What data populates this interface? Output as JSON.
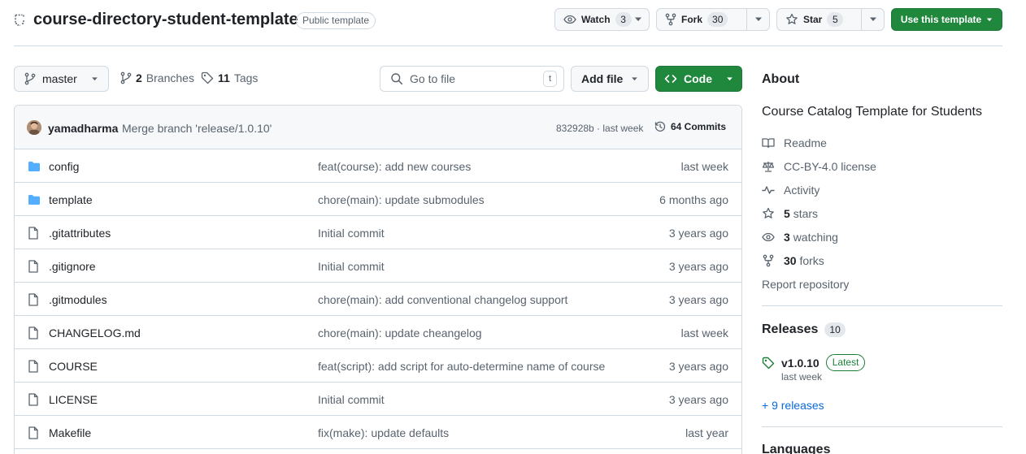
{
  "header": {
    "repo_name": "course-directory-student-template",
    "visibility": "Public template",
    "watch_label": "Watch",
    "watch_count": "3",
    "fork_label": "Fork",
    "fork_count": "30",
    "star_label": "Star",
    "star_count": "5",
    "use_template_label": "Use this template"
  },
  "nav": {
    "branch": "master",
    "branches_count": "2",
    "branches_label": "Branches",
    "tags_count": "11",
    "tags_label": "Tags",
    "go_to_file_placeholder": "Go to file",
    "go_to_file_key": "t",
    "add_file_label": "Add file",
    "code_label": "Code"
  },
  "commit": {
    "author": "yamadharma",
    "message": "Merge branch 'release/1.0.10'",
    "hash_time": "832928b · last week",
    "commits_label": "64 Commits"
  },
  "files": [
    {
      "name": "config",
      "type": "folder",
      "message": "feat(course): add new courses",
      "date": "last week"
    },
    {
      "name": "template",
      "type": "folder",
      "message": "chore(main): update submodules",
      "date": "6 months ago"
    },
    {
      "name": ".gitattributes",
      "type": "file",
      "message": "Initial commit",
      "date": "3 years ago"
    },
    {
      "name": ".gitignore",
      "type": "file",
      "message": "Initial commit",
      "date": "3 years ago"
    },
    {
      "name": ".gitmodules",
      "type": "file",
      "message": "chore(main): add conventional changelog support",
      "date": "3 years ago"
    },
    {
      "name": "CHANGELOG.md",
      "type": "file",
      "message": "chore(main): update cheangelog",
      "date": "last week"
    },
    {
      "name": "COURSE",
      "type": "file",
      "message": "feat(script): add script for auto-determine name of course",
      "date": "3 years ago"
    },
    {
      "name": "LICENSE",
      "type": "file",
      "message": "Initial commit",
      "date": "3 years ago"
    },
    {
      "name": "Makefile",
      "type": "file",
      "message": "fix(make): update defaults",
      "date": "last year"
    }
  ],
  "about": {
    "title": "About",
    "description": "Course Catalog Template for Students",
    "readme": "Readme",
    "license": "CC-BY-4.0 license",
    "activity": "Activity",
    "stars_count": "5",
    "stars_label": "stars",
    "watching_count": "3",
    "watching_label": "watching",
    "forks_count": "30",
    "forks_label": "forks",
    "report": "Report repository"
  },
  "releases": {
    "title": "Releases",
    "count": "10",
    "latest_tag": "v1.0.10",
    "latest_badge": "Latest",
    "latest_date": "last week",
    "more": "+ 9 releases"
  },
  "languages": {
    "title": "Languages"
  },
  "colors": {
    "primary_green": "#1f883d",
    "link_blue": "#0969da",
    "folder_blue": "#54aeff",
    "border": "#d1d9e0",
    "muted_text": "#59636e"
  }
}
